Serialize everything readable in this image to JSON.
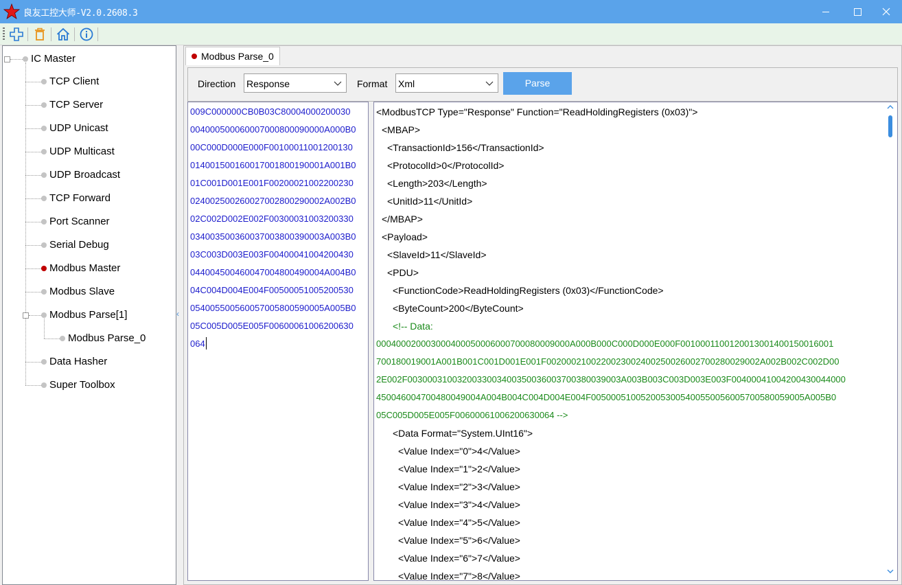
{
  "window": {
    "title": "良友工控大师-V2.0.2608.3"
  },
  "colors": {
    "titlebar": "#5aa3ea",
    "toolbar": "#e8f4e8",
    "hex_text": "#1c1ccc",
    "comment": "#1a8a1a",
    "active_dot": "#c00000",
    "parse_button": "#5aa3ea"
  },
  "toolbar": {
    "buttons": [
      "add-icon",
      "delete-icon",
      "home-icon",
      "info-icon"
    ]
  },
  "tree": {
    "root": "IC Master",
    "items": [
      "TCP Client",
      "TCP Server",
      "UDP Unicast",
      "UDP Multicast",
      "UDP Broadcast",
      "TCP Forward",
      "Port Scanner",
      "Serial Debug",
      "Modbus Master",
      "Modbus Slave",
      "Modbus Parse[1]",
      "Modbus Parse_0",
      "Data Hasher",
      "Super Toolbox"
    ]
  },
  "tab": {
    "label": "Modbus Parse_0"
  },
  "options": {
    "direction_label": "Direction",
    "direction_value": "Response",
    "format_label": "Format",
    "format_value": "Xml",
    "parse_label": "Parse"
  },
  "hex_lines": [
    "009C000000CB0B03C80004000200030",
    "004000500060007000800090000A000B0",
    "00C000D000E000F00100011001200130",
    "014001500160017001800190001A001B0",
    "01C001D001E001F00200021002200230",
    "024002500260027002800290002A002B0",
    "02C002D002E002F00300031003200330",
    "034003500360037003800390003A003B0",
    "03C003D003E003F00400041004200430",
    "044004500460047004800490004A004B0",
    "04C004D004E004F00500051005200530",
    "054005500560057005800590005A005B0",
    "05C005D005E005F00600061006200630",
    "064"
  ],
  "xml_lines": [
    "<ModbusTCP Type=\"Response\" Function=\"ReadHoldingRegisters (0x03)\">",
    "<MBAP>",
    "<TransactionId>156</TransactionId>",
    "<ProtocolId>0</ProtocolId>",
    "<Length>203</Length>",
    "<UnitId>11</UnitId>",
    "</MBAP>",
    "<Payload>",
    "<SlaveId>11</SlaveId>",
    "<PDU>",
    "<FunctionCode>ReadHoldingRegisters (0x03)</FunctionCode>",
    "<ByteCount>200</ByteCount>",
    "<!-- Data:",
    "000400020003000400050006000700080009000A000B000C000D000E000F0010001100120013001400150016001",
    "700180019001A001B001C001D001E001F0020002100220023002400250026002700280029002A002B002C002D00",
    "2E002F0030003100320033003400350036003700380039003A003B003C003D003E003F00400041004200430044000",
    "450046004700480049004A004B004C004D004E004F0050005100520053005400550056005700580059005A005B0",
    "05C005D005E005F00600061006200630064 -->",
    "<Data Format=\"System.UInt16\">",
    "<Value Index=\"0\">4</Value>",
    "<Value Index=\"1\">2</Value>",
    "<Value Index=\"2\">3</Value>",
    "<Value Index=\"3\">4</Value>",
    "<Value Index=\"4\">5</Value>",
    "<Value Index=\"5\">6</Value>",
    "<Value Index=\"6\">7</Value>",
    "<Value Index=\"7\">8</Value>"
  ]
}
